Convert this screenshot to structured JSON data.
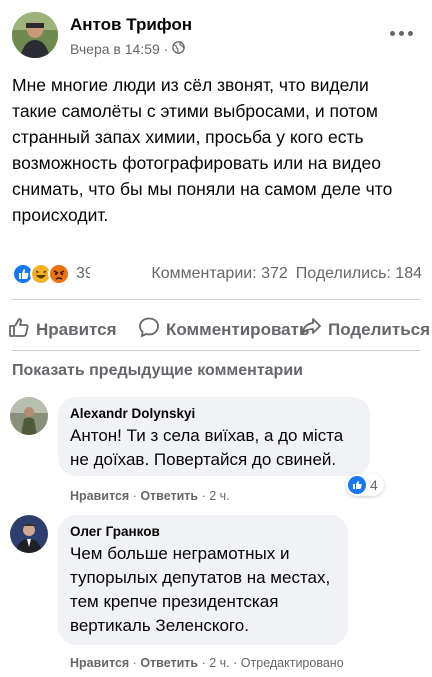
{
  "post": {
    "author": "Антов Трифон",
    "time": "Вчера в 14:59",
    "dot": "·",
    "privacy_icon": "globe-icon",
    "text": "Мне многие люди из сёл звонят, что видели\nтакие самолёты с этими выбросами, и потом\nстранный запах химии, просьба у кого есть\nвозможность фотографировать или на видео\nснимать, что бы мы поняли на самом деле что\nпроисходит.",
    "reaction_icons": [
      "like-icon",
      "haha-icon",
      "angry-icon"
    ],
    "reaction_count": "39",
    "comments": "Комментарии: 372",
    "shares": "Поделились: 184"
  },
  "actions": {
    "like": "Нравится",
    "comment": "Комментировать",
    "share": "Поделиться"
  },
  "show_previous": "Показать предыдущие комментарии",
  "comments": [
    {
      "name": "Alexandr Dolynskyi",
      "text": "Антон! Ти з села виїхав, а до міста\nне доїхав. Повертайся до свиней.",
      "like": "Нравится",
      "reply": "Ответить",
      "sep": "·",
      "time": "2 ч.",
      "reaction_count": "4"
    },
    {
      "name": "Олег Гранков",
      "text": "Чем больше неграмотных и\nтупорылых депутатов на местах,\nтем крепче президентская\nвертикаль Зеленского.",
      "like": "Нравится",
      "reply": "Ответить",
      "sep": "·",
      "time": "2 ч.",
      "edited": "Отредактировано"
    }
  ],
  "colors": {
    "secondary_text": "#65676b",
    "bubble": "#f0f2f5",
    "like_blue": "#1877f2",
    "haha_yellow": "#f7b125",
    "angry_orange": "#e9710f"
  }
}
